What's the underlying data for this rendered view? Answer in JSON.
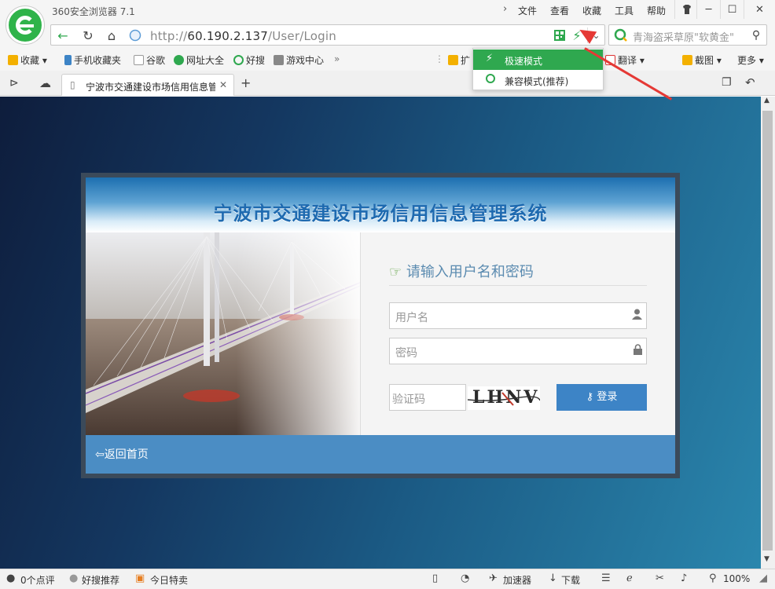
{
  "browser": {
    "app_title": "360安全浏览器 7.1",
    "menus": [
      "文件",
      "查看",
      "收藏",
      "工具",
      "帮助"
    ],
    "url_prefix": "http://",
    "url_host": "60.190.2.137",
    "url_path": "/User/Login",
    "search_text": "青海盗采草原\"软黄金\"",
    "bookmarks": {
      "favorites": "收藏",
      "mobile": "手机收藏夹",
      "google": "谷歌",
      "nav": "网址大全",
      "haosou": "好搜",
      "games": "游戏中心",
      "more_chevron": "»",
      "ext": "扩",
      "translate": "翻译",
      "screenshot": "截图",
      "more": "更多"
    },
    "tab_title": "宁波市交通建设市场信用信息管",
    "mode_menu": {
      "fast": "极速模式",
      "compat": "兼容模式(推荐)"
    }
  },
  "page": {
    "system_title": "宁波市交通建设市场信用信息管理系统",
    "form_heading": "请输入用户名和密码",
    "username_placeholder": "用户名",
    "password_placeholder": "密码",
    "captcha_placeholder": "验证码",
    "captcha_text": "LHNV",
    "login_label": "登录",
    "back_home": "返回首页"
  },
  "statusbar": {
    "comments": "0个点评",
    "recommend": "好搜推荐",
    "deals": "今日特卖",
    "accelerator": "加速器",
    "download": "下载",
    "zoom": "100%"
  },
  "colors": {
    "accent_green": "#2fa84f",
    "login_blue": "#3d84c6",
    "title_blue": "#1e6ab0",
    "arrow_red": "#e53935"
  }
}
